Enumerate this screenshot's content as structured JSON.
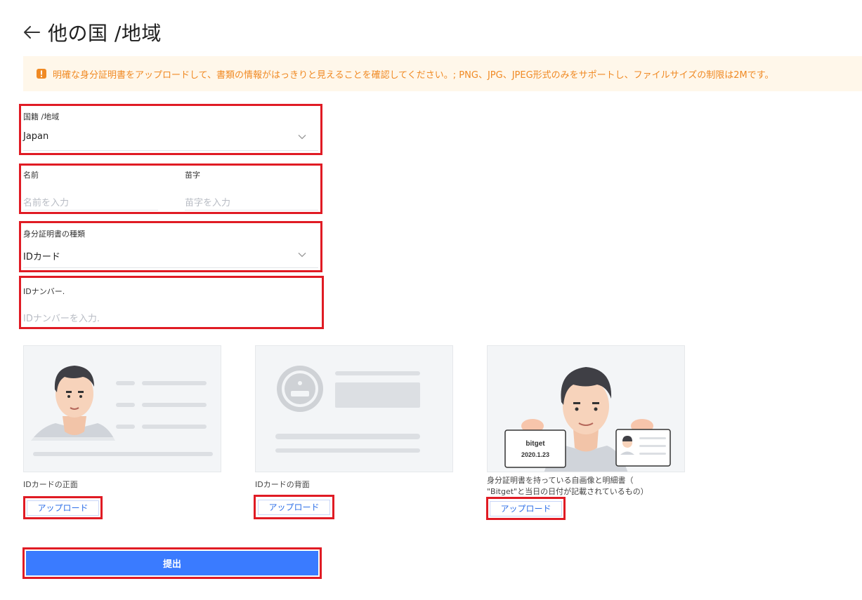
{
  "header": {
    "title": "他の国 /地域",
    "back_icon": "arrow-left-icon"
  },
  "notice": {
    "icon": "warning-icon",
    "text": "明確な身分証明書をアップロードして、書類の情報がはっきりと見えることを確認してください。; PNG、JPG、JPEG形式のみをサポートし、ファイルサイズの制限は2Mです。",
    "color": "#f08a24",
    "background": "#fff7ea"
  },
  "form": {
    "nationality": {
      "label": "国籍 /地域",
      "value": "Japan"
    },
    "first_name": {
      "label": "名前",
      "placeholder": "名前を入力"
    },
    "last_name": {
      "label": "苗字",
      "placeholder": "苗字を入力"
    },
    "id_type": {
      "label": "身分証明書の種類",
      "value": "IDカード"
    },
    "id_number": {
      "label": "IDナンバー.",
      "placeholder": "IDナンバーを入力."
    }
  },
  "uploads": [
    {
      "caption": "IDカードの正面",
      "button": "アップロード"
    },
    {
      "caption": "IDカードの背面",
      "button": "アップロード"
    },
    {
      "caption_line1": "身分証明書を持っている自画像と明細書（",
      "caption_line2": "\"Bitget\"と当日の日付が記載されているもの）",
      "button": "アップロード",
      "sign_brand": "bitget",
      "sign_date": "2020.1.23"
    }
  ],
  "submit": {
    "label": "提出",
    "color": "#3a7bff"
  },
  "accent": "#2e6fe8",
  "highlight": "#e01b24"
}
